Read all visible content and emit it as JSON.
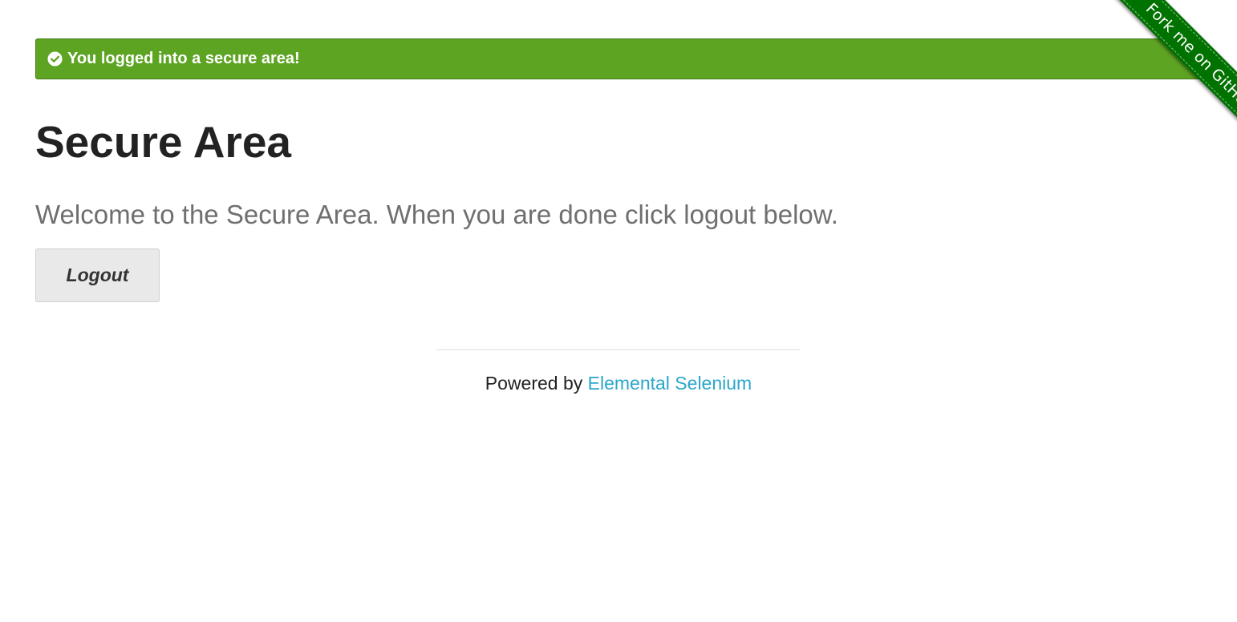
{
  "flash": {
    "message": "You logged into a secure area!",
    "close_label": "×",
    "icon": "check-circle-icon",
    "color": "#5da423"
  },
  "main": {
    "title": "Secure Area",
    "subheader": "Welcome to the Secure Area. When you are done click logout below.",
    "logout_label": "Logout"
  },
  "footer": {
    "powered_by": "Powered by ",
    "link_text": "Elemental Selenium",
    "link_color": "#2ba6cb"
  },
  "ribbon": {
    "label": "Fork me on GitHub",
    "color": "#007200"
  }
}
